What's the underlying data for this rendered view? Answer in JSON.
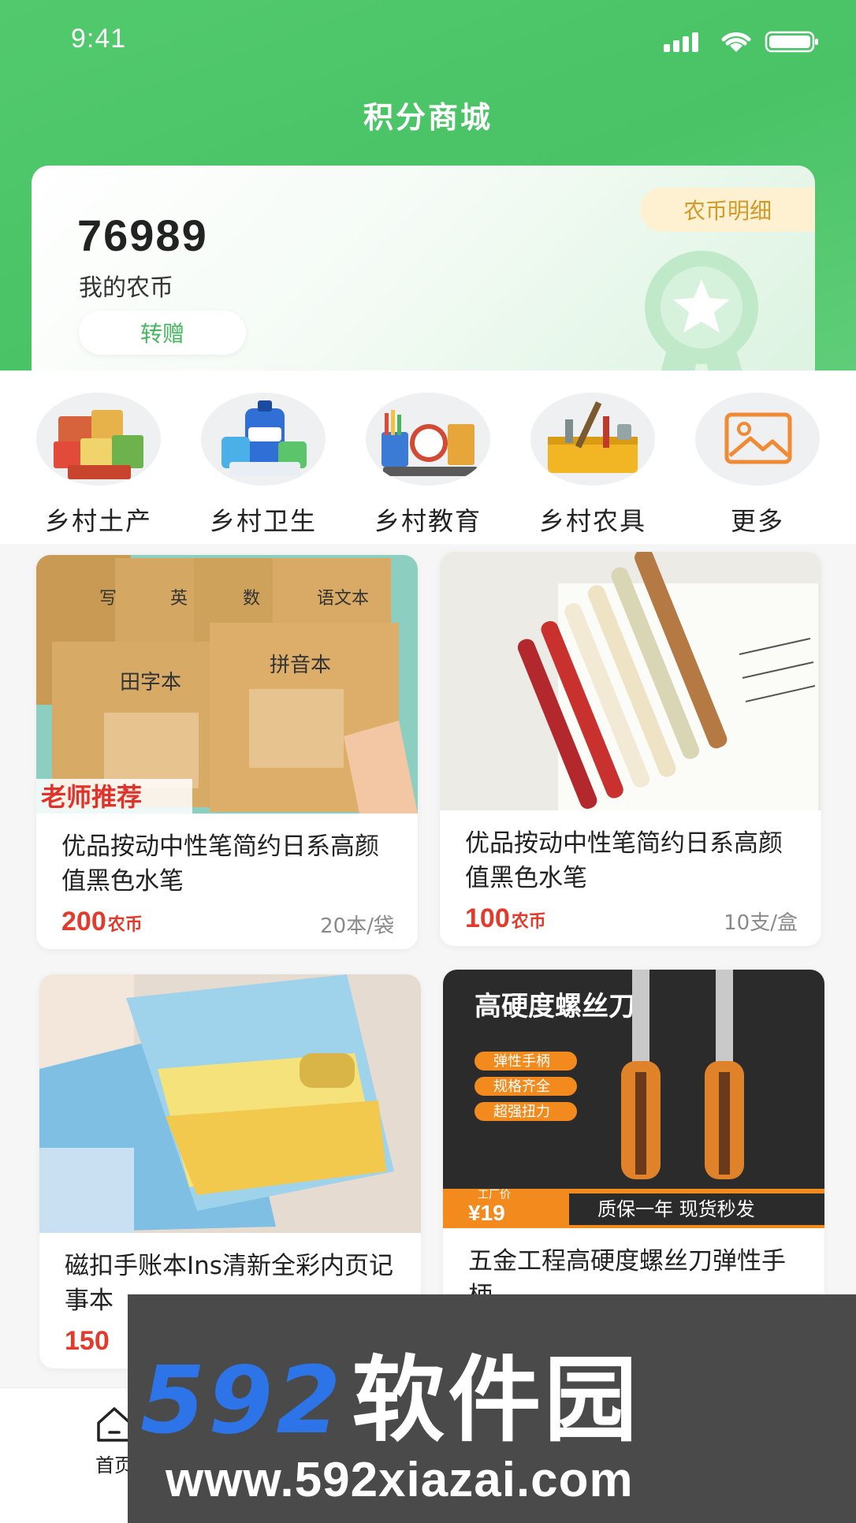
{
  "status_bar": {
    "time": "9:41"
  },
  "page": {
    "title": "积分商城"
  },
  "coin_card": {
    "amount": "76989",
    "label": "我的农币",
    "transfer_label": "转赠",
    "detail_label": "农币明细"
  },
  "categories": [
    {
      "label": "乡村土产",
      "icon": "local-produce-image"
    },
    {
      "label": "乡村卫生",
      "icon": "hygiene-products-image"
    },
    {
      "label": "乡村教育",
      "icon": "stationery-image"
    },
    {
      "label": "乡村农具",
      "icon": "toolbox-image"
    },
    {
      "label": "更多",
      "icon": "image-icon"
    }
  ],
  "products": [
    {
      "name": "优品按动中性笔简约日系高颜值黑色水笔",
      "price": "200",
      "unit": "农币",
      "spec": "20本/袋",
      "badge": "老师推荐",
      "image_labels": [
        "田字本",
        "拼音本",
        "语文本",
        "数",
        "英",
        "写"
      ]
    },
    {
      "name": "优品按动中性笔简约日系高颜值黑色水笔",
      "price": "100",
      "unit": "农币",
      "spec": "10支/盒"
    },
    {
      "name": "磁扣手账本Ins清新全彩内页记事本",
      "price": "150",
      "unit": "",
      "spec": ""
    },
    {
      "name": "五金工程高硬度螺丝刀弹性手柄",
      "price": "",
      "unit": "",
      "spec": "",
      "image_title": "高硬度螺丝刀",
      "image_tags": [
        "弹性手柄",
        "规格齐全",
        "超强扭力"
      ],
      "image_price_label": "工厂价",
      "image_price": "¥19",
      "image_banner": "质保一年 现货秒发"
    }
  ],
  "tabbar": {
    "home_label": "首页"
  },
  "watermark": {
    "number": "592",
    "brand": "软件园",
    "url": "www.592xiazai.com"
  },
  "colors": {
    "primary_green": "#49c366",
    "price_red": "#e33a2c",
    "detail_gold": "#d39a2a"
  }
}
